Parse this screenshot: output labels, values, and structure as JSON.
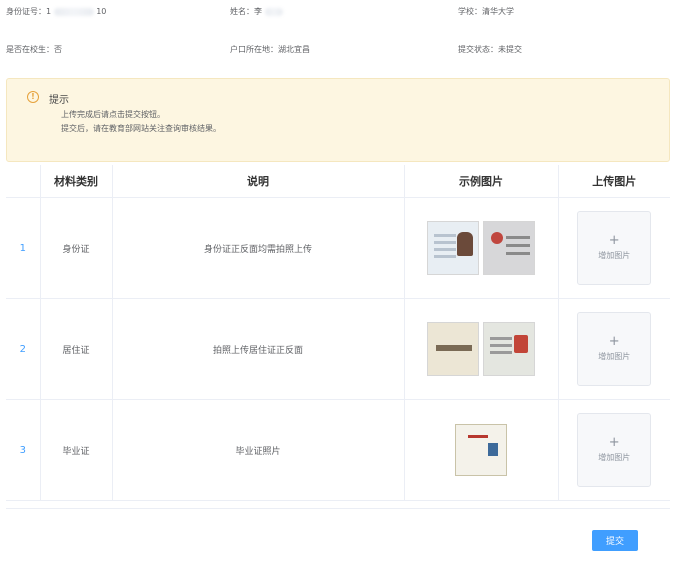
{
  "student": {
    "id_label": "身份证号：",
    "id_prefix": "1",
    "id_suffix": "10",
    "name_label": "姓名：",
    "name_value": "李",
    "school_label": "学校：",
    "school_value": "清华大学",
    "in_school_label": "是否在校生：",
    "in_school_value": "否",
    "hukou_label": "户口所在地：",
    "hukou_value": "湖北宜昌",
    "status_label": "提交状态：",
    "status_value": "未提交"
  },
  "alert": {
    "icon": "info-circle-icon",
    "title": "提示",
    "lines": [
      "上传完成后请点击提交按钮。",
      "提交后，请在教育部网站关注查询审核结果。"
    ]
  },
  "table": {
    "headers": [
      "",
      "材料类别",
      "说明",
      "示例图片",
      "上传图片"
    ],
    "rows": [
      {
        "index": "1",
        "category": "身份证",
        "description": "身份证正反面均需拍照上传",
        "upload_plus": "+",
        "upload_label": "增加图片"
      },
      {
        "index": "2",
        "category": "居住证",
        "description": "拍照上传居住证正反面",
        "upload_plus": "+",
        "upload_label": "增加图片"
      },
      {
        "index": "3",
        "category": "毕业证",
        "description": "毕业证照片",
        "upload_plus": "+",
        "upload_label": "增加图片"
      }
    ]
  },
  "actions": {
    "submit_label": "提交"
  },
  "colors": {
    "accent": "#409eff",
    "alert_bg": "#fdf6e1",
    "warning": "#e6a23c"
  }
}
